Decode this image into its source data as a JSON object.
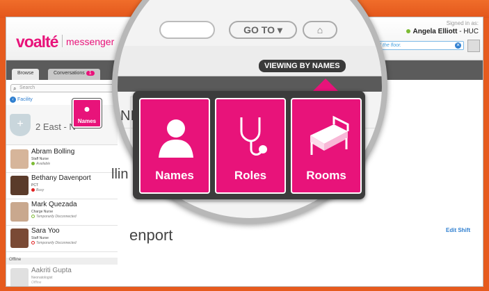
{
  "app": {
    "logo": "voalté",
    "logo_sub": "messenger",
    "signed_in_label": "Signed in as:",
    "user_name": "Angela Elliott",
    "user_role": "- HUC",
    "status_text": "…ing off the floor.",
    "colors": {
      "brand": "#e8137a",
      "accent_blue": "#2f7fd0",
      "online": "#7dbb35"
    }
  },
  "tabs": [
    {
      "label": "Browse"
    },
    {
      "label": "Conversations",
      "badge": "1"
    }
  ],
  "search": {
    "placeholder": "Search"
  },
  "breadcrumb": "Facility",
  "unit": {
    "name": "2 East - N"
  },
  "mini_names_label": "Names",
  "contacts": [
    {
      "name": "Abram Bolling",
      "role": "Staff Nurse",
      "status": "Available",
      "status_color": "#7dbb35"
    },
    {
      "name": "Bethany Davenport",
      "role": "PCT",
      "status": "Busy",
      "status_color": "#e02020"
    },
    {
      "name": "Mark Quezada",
      "role": "Charge Nurse",
      "status": "Temporarily Disconnected",
      "status_color": "#7dbb35"
    },
    {
      "name": "Sara Yoo",
      "role": "Staff Nurse",
      "status": "Temporarily Disconnected",
      "status_color": "#e02020"
    }
  ],
  "offline_label": "Offline",
  "offline_contact": {
    "name": "Aakriti Gupta",
    "role": "Neonatologist",
    "status": "Offline"
  },
  "edit_shift": "Edit Shift",
  "zoom": {
    "goto_label": "GO TO ▾",
    "viewing_label": "VIEWING BY NAMES",
    "partial_text_1": "NI",
    "partial_text_2": "llin",
    "partial_text_3": "enport",
    "buttons": [
      {
        "label": "Names",
        "icon": "person-icon"
      },
      {
        "label": "Roles",
        "icon": "stethoscope-icon"
      },
      {
        "label": "Rooms",
        "icon": "bed-icon"
      }
    ]
  }
}
